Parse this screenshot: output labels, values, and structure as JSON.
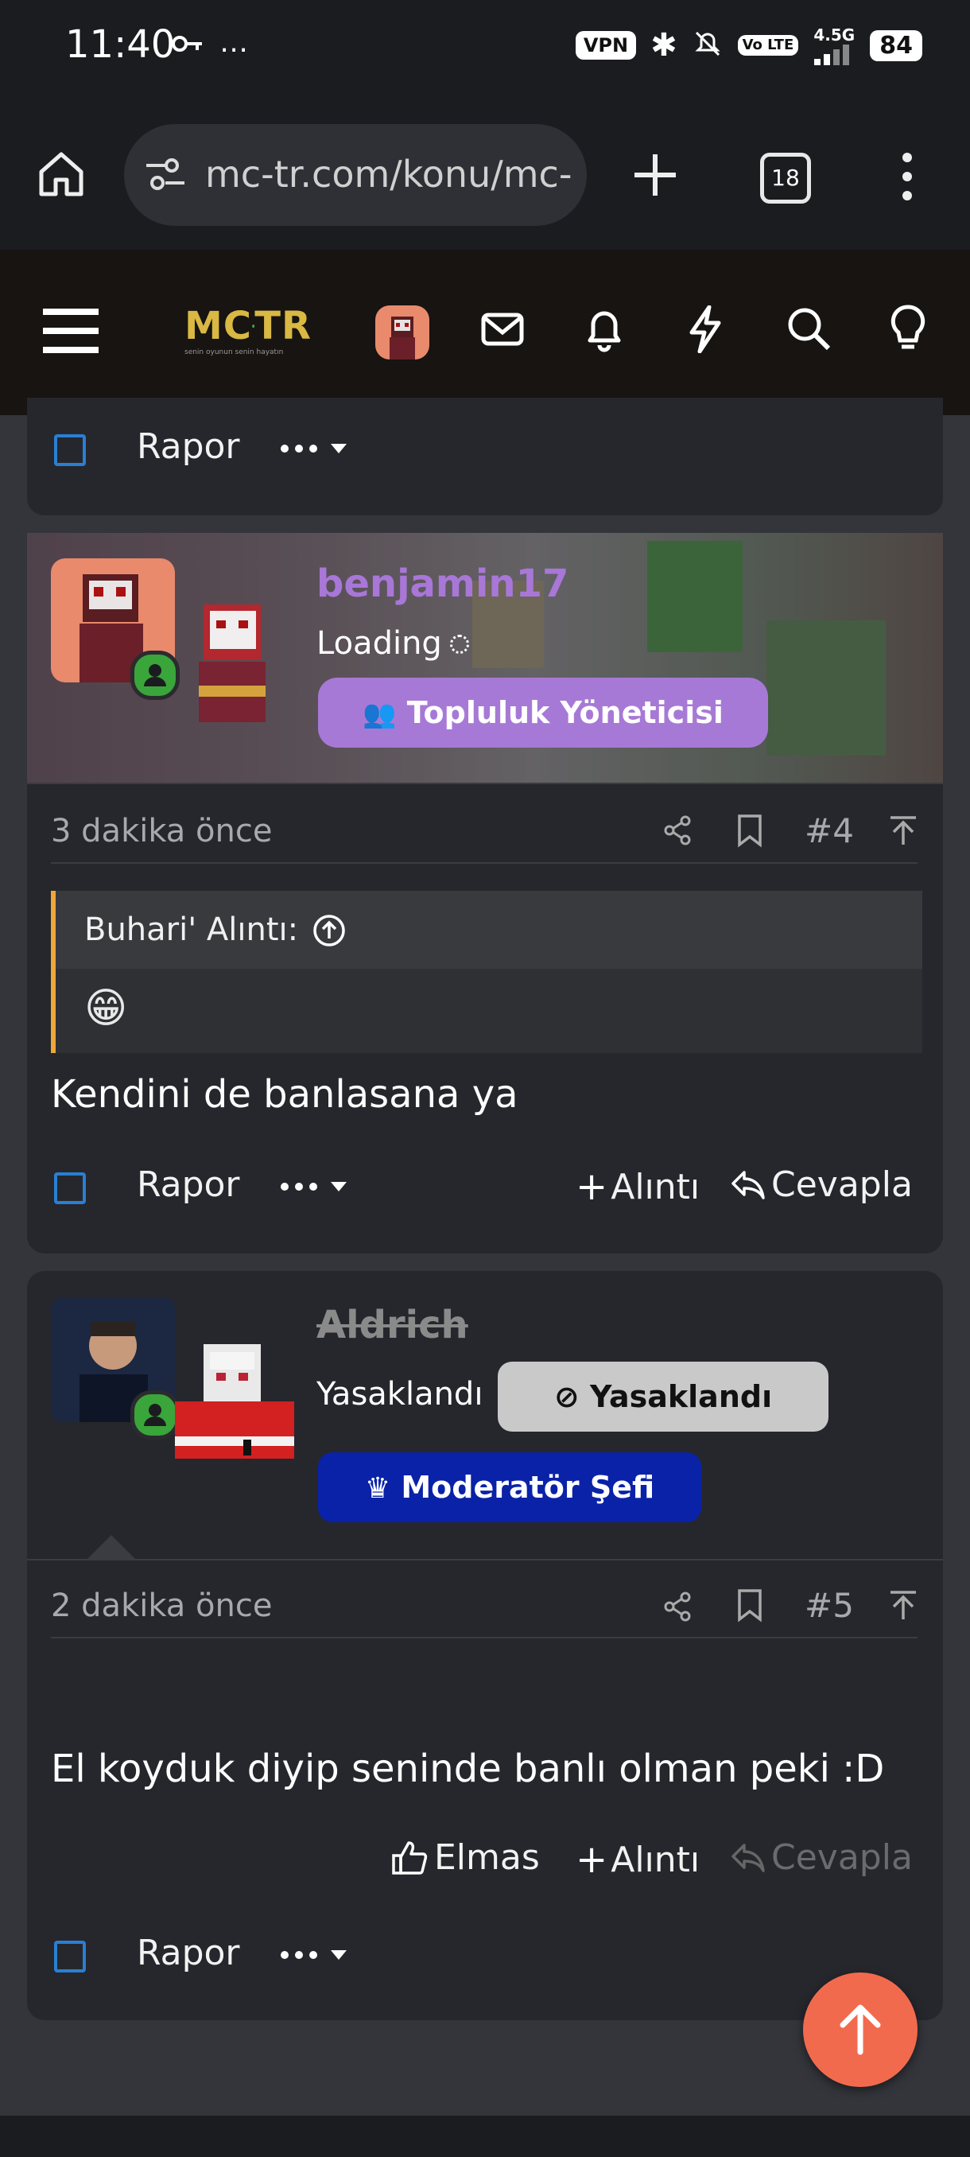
{
  "status": {
    "time": "11:40",
    "vpn": "VPN",
    "volte": "Vo LTE",
    "network": "4.5G",
    "battery": "84"
  },
  "browser": {
    "url": "mc-tr.com/konu/mc-t",
    "tab_count": "18"
  },
  "site": {
    "logo_text": "MC",
    "logo_text2": "TR",
    "logo_sub": "senin oyunun senin hayatın"
  },
  "post_top": {
    "report_label": "Rapor"
  },
  "post4": {
    "username": "benjamin17",
    "status": "Loading",
    "role": "Topluluk Yöneticisi",
    "time": "3 dakika önce",
    "number": "#4",
    "quote_author": "Buhari' Alıntı:",
    "quote_emoji": "😁",
    "body": "Kendini de banlasana ya",
    "report_label": "Rapor",
    "quote_button": "Alıntı",
    "reply_button": "Cevapla"
  },
  "post5": {
    "username": "Aldrich",
    "status": "Yasaklandı",
    "banned_badge": "Yasaklandı",
    "role": "Moderatör Şefi",
    "time": "2 dakika önce",
    "number": "#5",
    "body": "El koyduk diyip seninde banlı olman peki :D",
    "like_button": "Elmas",
    "quote_button": "Alıntı",
    "reply_button": "Cevapla",
    "report_label": "Rapor"
  },
  "colors": {
    "accent": "#f26a4e",
    "username": "#a877d8",
    "role_topluluk": "#a779d6",
    "role_moderator": "#0a22a8",
    "checkbox": "#2a7fd3",
    "quote_border": "#f0a73a"
  }
}
